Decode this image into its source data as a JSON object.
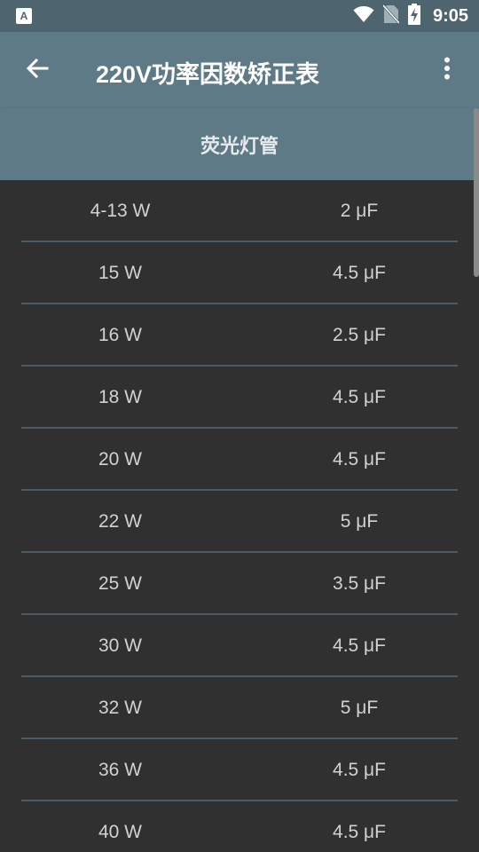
{
  "status_bar": {
    "app_icon_letter": "A",
    "time": "9:05"
  },
  "app_bar": {
    "title": "220V功率因数矫正表"
  },
  "section": {
    "title": "荧光灯管"
  },
  "rows": [
    {
      "power": "4-13 W",
      "capacitance": "2 μF"
    },
    {
      "power": "15 W",
      "capacitance": "4.5 μF"
    },
    {
      "power": "16 W",
      "capacitance": "2.5 μF"
    },
    {
      "power": "18 W",
      "capacitance": "4.5 μF"
    },
    {
      "power": "20 W",
      "capacitance": "4.5 μF"
    },
    {
      "power": "22 W",
      "capacitance": "5 μF"
    },
    {
      "power": "25 W",
      "capacitance": "3.5 μF"
    },
    {
      "power": "30 W",
      "capacitance": "4.5 μF"
    },
    {
      "power": "32 W",
      "capacitance": "5 μF"
    },
    {
      "power": "36 W",
      "capacitance": "4.5 μF"
    },
    {
      "power": "40 W",
      "capacitance": "4.5 μF"
    }
  ],
  "colors": {
    "status_bar": "#4e6570",
    "app_bar": "#5f7a87",
    "background": "#303030",
    "divider": "#4c5c64",
    "cell_text": "#d2d2d2"
  },
  "icons": [
    "back-arrow-icon",
    "more-vert-icon",
    "wifi-icon",
    "no-sim-icon",
    "battery-charging-icon"
  ]
}
